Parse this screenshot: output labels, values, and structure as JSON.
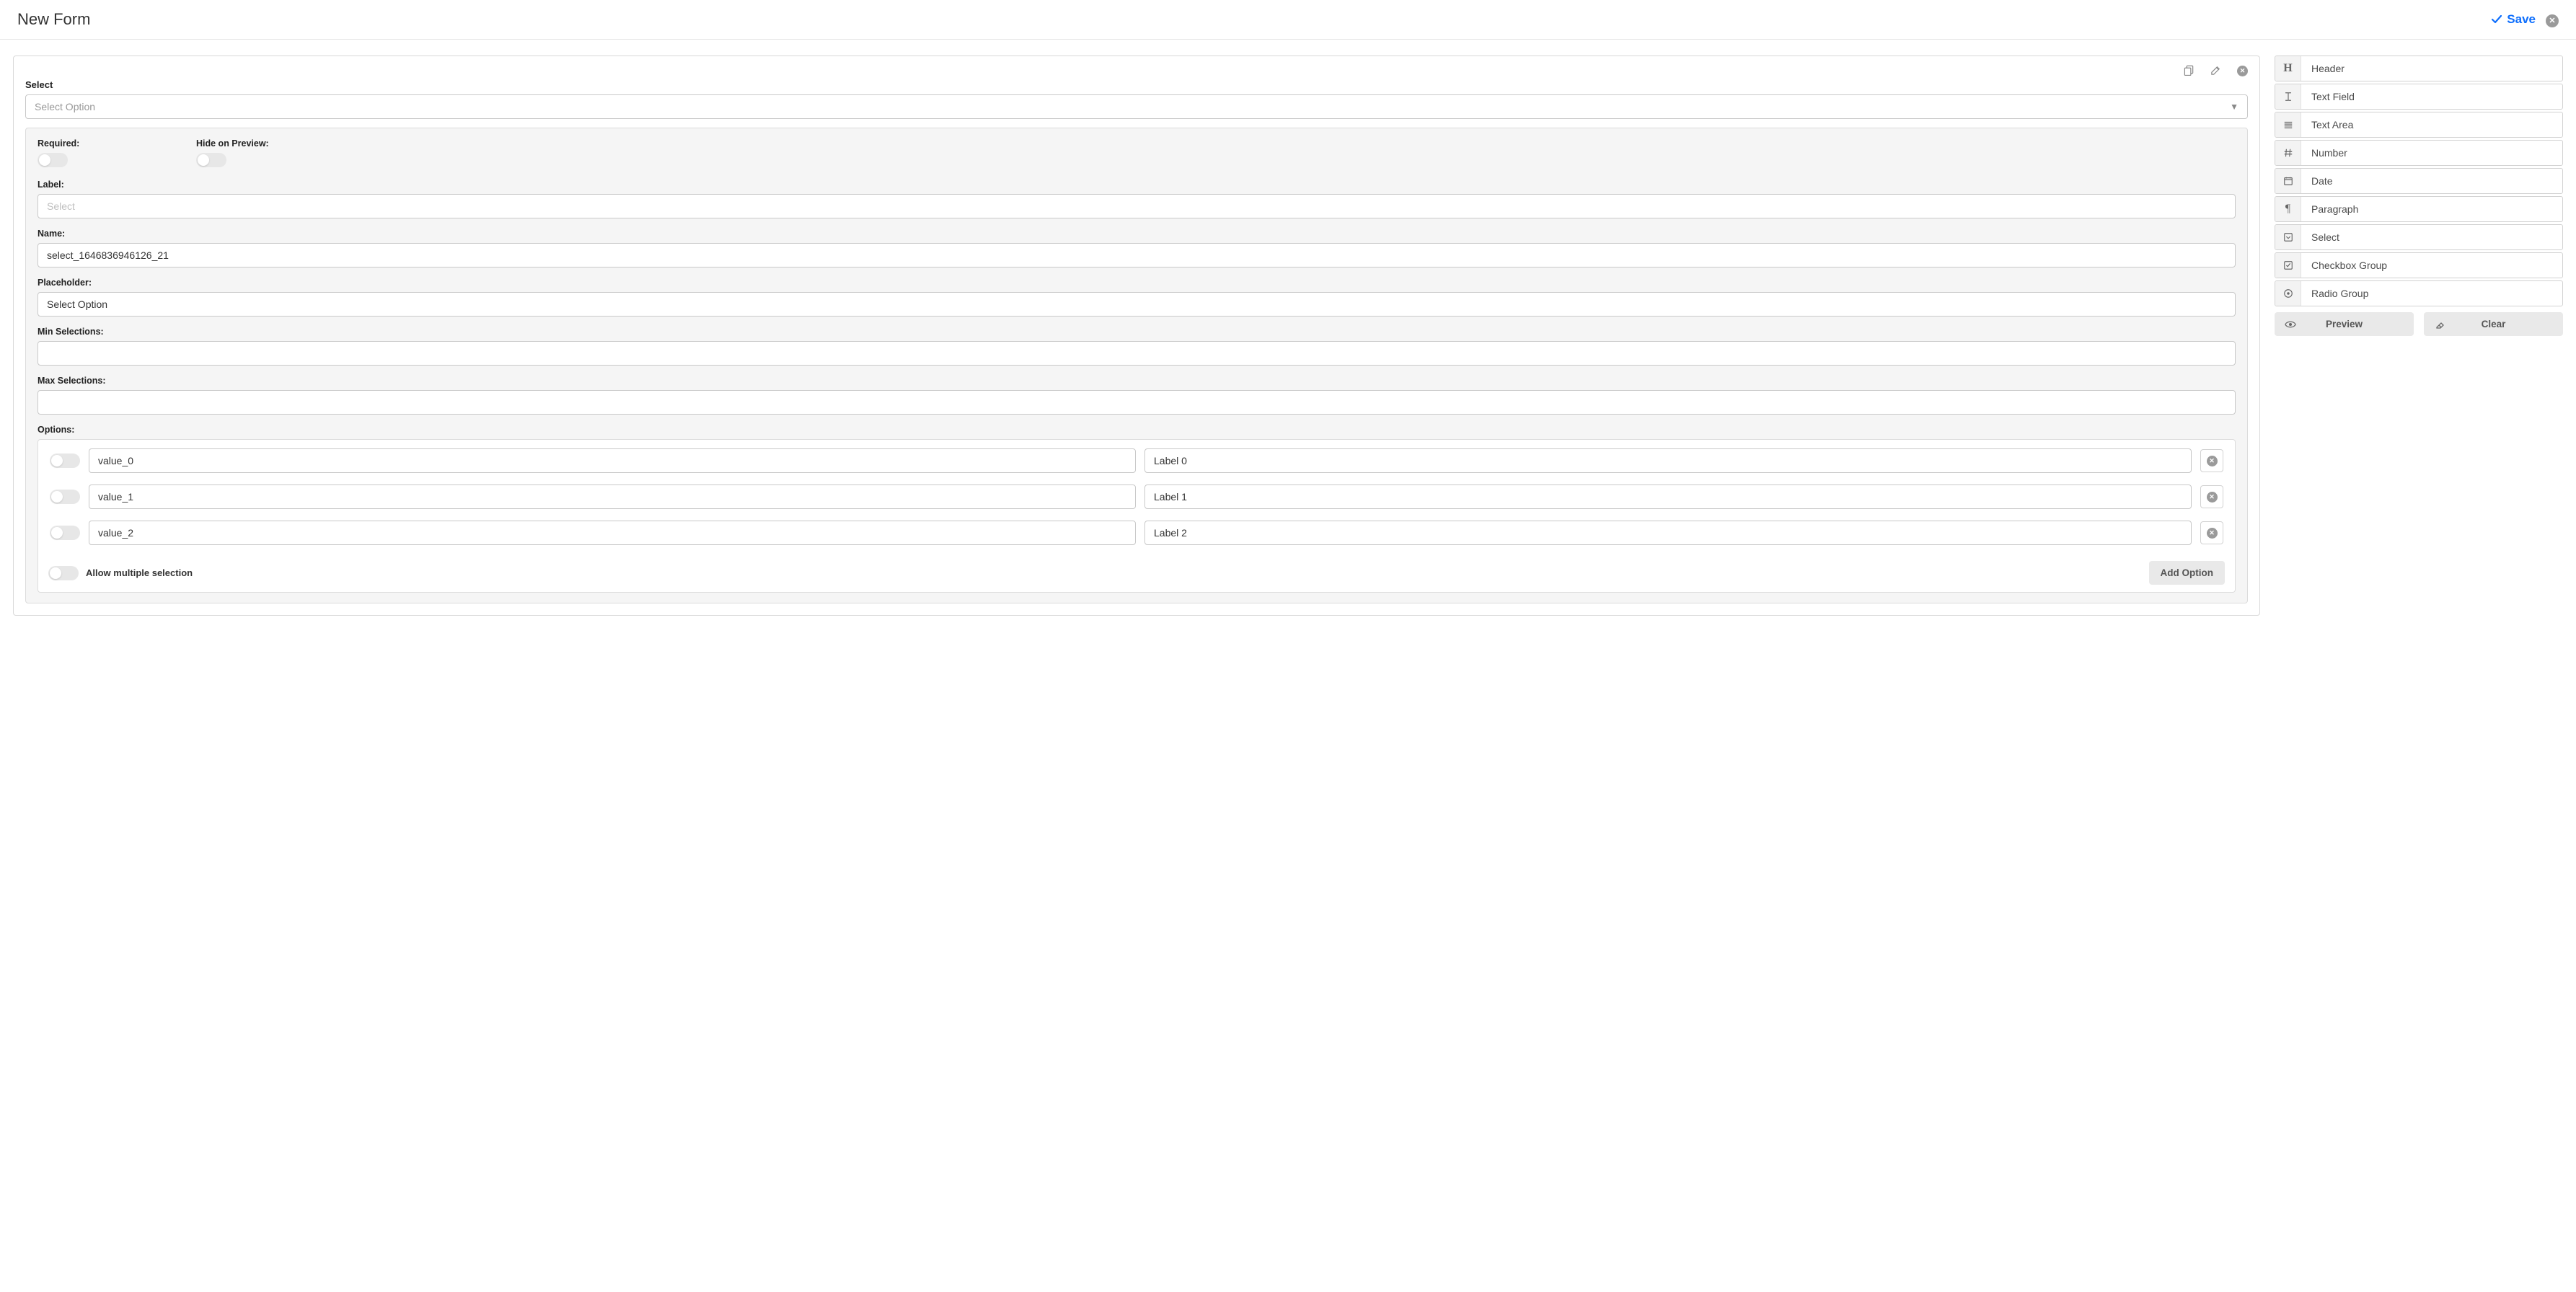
{
  "header": {
    "title": "New Form",
    "save_label": "Save"
  },
  "canvas": {
    "block_type_label": "Select",
    "select_placeholder": "Select Option",
    "tools": {
      "copy": "copy",
      "edit": "edit",
      "remove": "remove"
    }
  },
  "config": {
    "required_label": "Required:",
    "hide_on_preview_label": "Hide on Preview:",
    "label_label": "Label:",
    "label_placeholder": "Select",
    "label_value": "",
    "name_label": "Name:",
    "name_value": "select_1646836946126_21",
    "placeholder_label": "Placeholder:",
    "placeholder_value": "Select Option",
    "min_sel_label": "Min Selections:",
    "min_sel_value": "",
    "max_sel_label": "Max Selections:",
    "max_sel_value": "",
    "options_label": "Options:",
    "options": [
      {
        "value": "value_0",
        "label": "Label 0"
      },
      {
        "value": "value_1",
        "label": "Label 1"
      },
      {
        "value": "value_2",
        "label": "Label 2"
      }
    ],
    "allow_multi_label": "Allow multiple selection",
    "add_option_label": "Add Option"
  },
  "sidebar": {
    "items": [
      {
        "id": "header",
        "label": "Header",
        "icon": "H"
      },
      {
        "id": "text-field",
        "label": "Text Field",
        "icon": "text-cursor"
      },
      {
        "id": "text-area",
        "label": "Text Area",
        "icon": "lines"
      },
      {
        "id": "number",
        "label": "Number",
        "icon": "hash"
      },
      {
        "id": "date",
        "label": "Date",
        "icon": "calendar"
      },
      {
        "id": "paragraph",
        "label": "Paragraph",
        "icon": "pilcrow"
      },
      {
        "id": "select",
        "label": "Select",
        "icon": "caret-square"
      },
      {
        "id": "checkbox-group",
        "label": "Checkbox Group",
        "icon": "check-square"
      },
      {
        "id": "radio-group",
        "label": "Radio Group",
        "icon": "dot-circle"
      }
    ],
    "preview_label": "Preview",
    "clear_label": "Clear"
  }
}
